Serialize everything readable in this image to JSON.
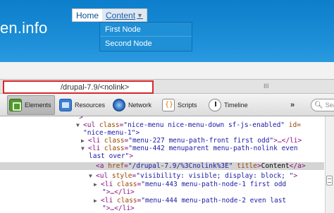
{
  "site": {
    "name_fragment": "en.info"
  },
  "nav": {
    "home_label": "Home",
    "content_label": "Content",
    "dropdown_items": [
      "First Node",
      "Second Node"
    ]
  },
  "url_bar": {
    "value": "/drupal-7.9/<nolink>",
    "grip": "III"
  },
  "devtools": {
    "tabs": {
      "elements": "Elements",
      "resources": "Resources",
      "network": "Network",
      "scripts": "Scripts",
      "timeline": "Timeline"
    },
    "more": "»",
    "search_placeholder": "Sear"
  },
  "tree": {
    "l0": ">",
    "l1": {
      "tag_open": "<ul",
      "attr1": "class",
      "val1": "\"nice-menu nice-menu-down sf-js-enabled\"",
      "attr2": "id="
    },
    "l1b": {
      "val2": "\"nice-menu-1\">"
    },
    "l2": {
      "tag_open": "<li",
      "attr1": "class",
      "val1": "\"menu-227 menu-path-front first  odd\"",
      "rest": ">…</li>"
    },
    "l3": {
      "tag_open": "<li",
      "attr1": "class",
      "val1": "\"menu-442 menuparent menu-path-nolink even"
    },
    "l3b": {
      "val1_cont": "last over\"",
      "close": ">"
    },
    "l4": {
      "tag_open": "<a",
      "attr1": "href",
      "val1": "\"/drupal-7.9/%3Cnolink%3E\"",
      "attr2": "title",
      "text": "Content",
      "close": "</a>"
    },
    "l5": {
      "tag_open": "<ul",
      "attr1": "style",
      "val1": "\"visibility: visible; display: block; \"",
      "close": ">"
    },
    "l6": {
      "tag_open": "<li",
      "attr1": "class",
      "val1": "\"menu-443 menu-path-node-1 first  odd"
    },
    "l6b": {
      "val1_cont": "\"",
      "rest": ">…</li>"
    },
    "l7": {
      "tag_open": "<li",
      "attr1": "class",
      "val1": "\"menu-444 menu-path-node-2 even  last"
    },
    "l7b": {
      "val1_cont": "\"",
      "rest": ">…</li>"
    }
  }
}
